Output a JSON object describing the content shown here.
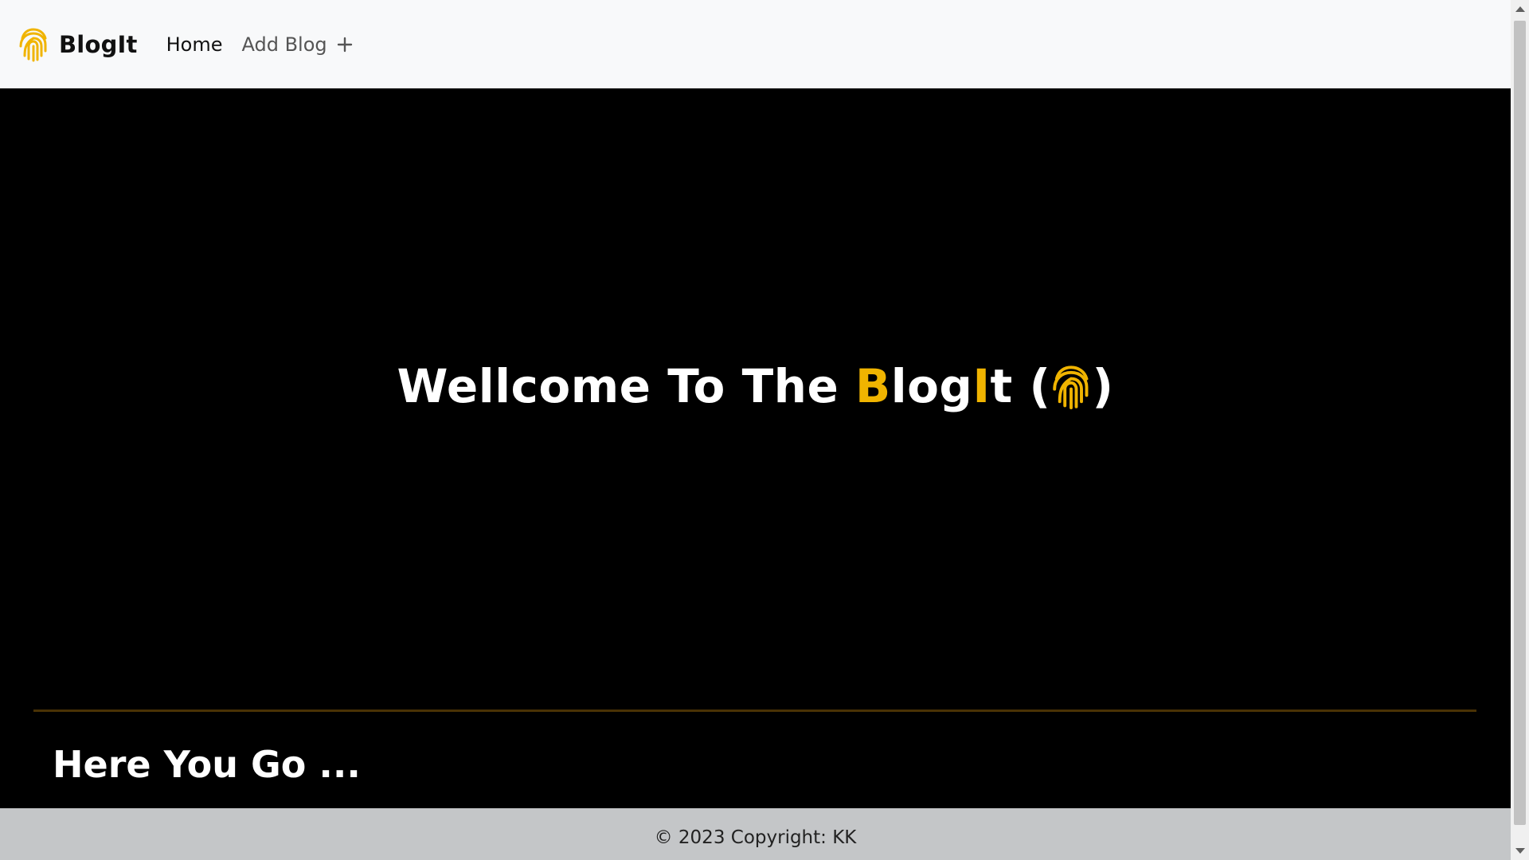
{
  "navbar": {
    "brand": "BlogIt",
    "links": [
      {
        "label": "Home"
      },
      {
        "label": "Add Blog"
      }
    ]
  },
  "hero": {
    "title_part1": "Wellcome To The ",
    "title_accent_b": "B",
    "title_log": "log",
    "title_accent_i": "I",
    "title_t": "t",
    "title_open": " (",
    "title_close": ")",
    "subheading": "Here You Go ..."
  },
  "footer": {
    "copyright": "© 2023 Copyright: KK"
  },
  "colors": {
    "accent": "#f0b400",
    "navbar_bg": "#f8f9fa",
    "hero_bg": "#000000",
    "footer_bg": "#c4c6c8",
    "divider": "#4a3205"
  },
  "icons": {
    "brand_logo": "fingerprint-icon",
    "add": "plus-icon"
  }
}
